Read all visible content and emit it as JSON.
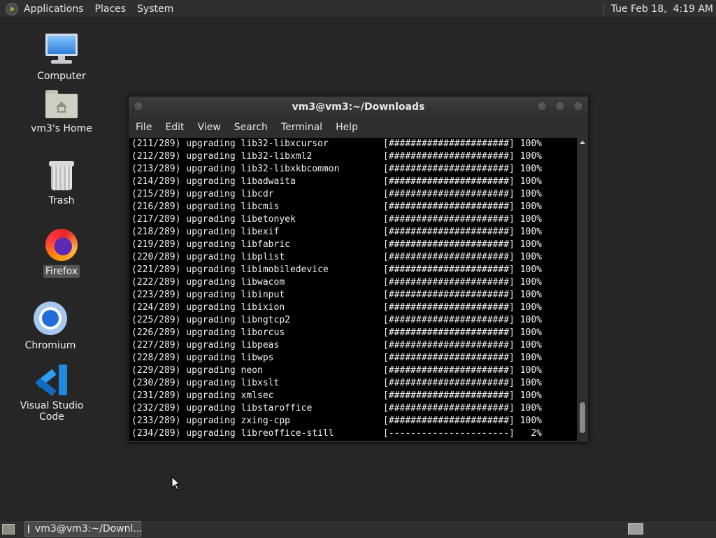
{
  "top_panel": {
    "menus": [
      "Applications",
      "Places",
      "System"
    ],
    "clock": "Tue Feb 18,  4:19 AM"
  },
  "desktop_icons": [
    {
      "label": "Computer"
    },
    {
      "label": "vm3's Home"
    },
    {
      "label": "Trash"
    },
    {
      "label": "Firefox"
    },
    {
      "label": "Chromium"
    },
    {
      "label": "Visual Studio Code"
    }
  ],
  "window": {
    "title": "vm3@vm3:~/Downloads",
    "menu": [
      "File",
      "Edit",
      "View",
      "Search",
      "Terminal",
      "Help"
    ],
    "lines": [
      "(211/289) upgrading lib32-libxcursor          [######################] 100%",
      "(212/289) upgrading lib32-libxml2             [######################] 100%",
      "(213/289) upgrading lib32-libxkbcommon        [######################] 100%",
      "(214/289) upgrading libadwaita                [######################] 100%",
      "(215/289) upgrading libcdr                    [######################] 100%",
      "(216/289) upgrading libcmis                   [######################] 100%",
      "(217/289) upgrading libetonyek                [######################] 100%",
      "(218/289) upgrading libexif                   [######################] 100%",
      "(219/289) upgrading libfabric                 [######################] 100%",
      "(220/289) upgrading libplist                  [######################] 100%",
      "(221/289) upgrading libimobiledevice          [######################] 100%",
      "(222/289) upgrading libwacom                  [######################] 100%",
      "(223/289) upgrading libinput                  [######################] 100%",
      "(224/289) upgrading libixion                  [######################] 100%",
      "(225/289) upgrading libngtcp2                 [######################] 100%",
      "(226/289) upgrading liborcus                  [######################] 100%",
      "(227/289) upgrading libpeas                   [######################] 100%",
      "(228/289) upgrading libwps                    [######################] 100%",
      "(229/289) upgrading neon                      [######################] 100%",
      "(230/289) upgrading libxslt                   [######################] 100%",
      "(231/289) upgrading xmlsec                    [######################] 100%",
      "(232/289) upgrading libstaroffice             [######################] 100%",
      "(233/289) upgrading zxing-cpp                 [######################] 100%",
      "(234/289) upgrading libreoffice-still         [----------------------]   2%"
    ]
  },
  "taskbar": {
    "task_label": "vm3@vm3:~/Downl..."
  }
}
